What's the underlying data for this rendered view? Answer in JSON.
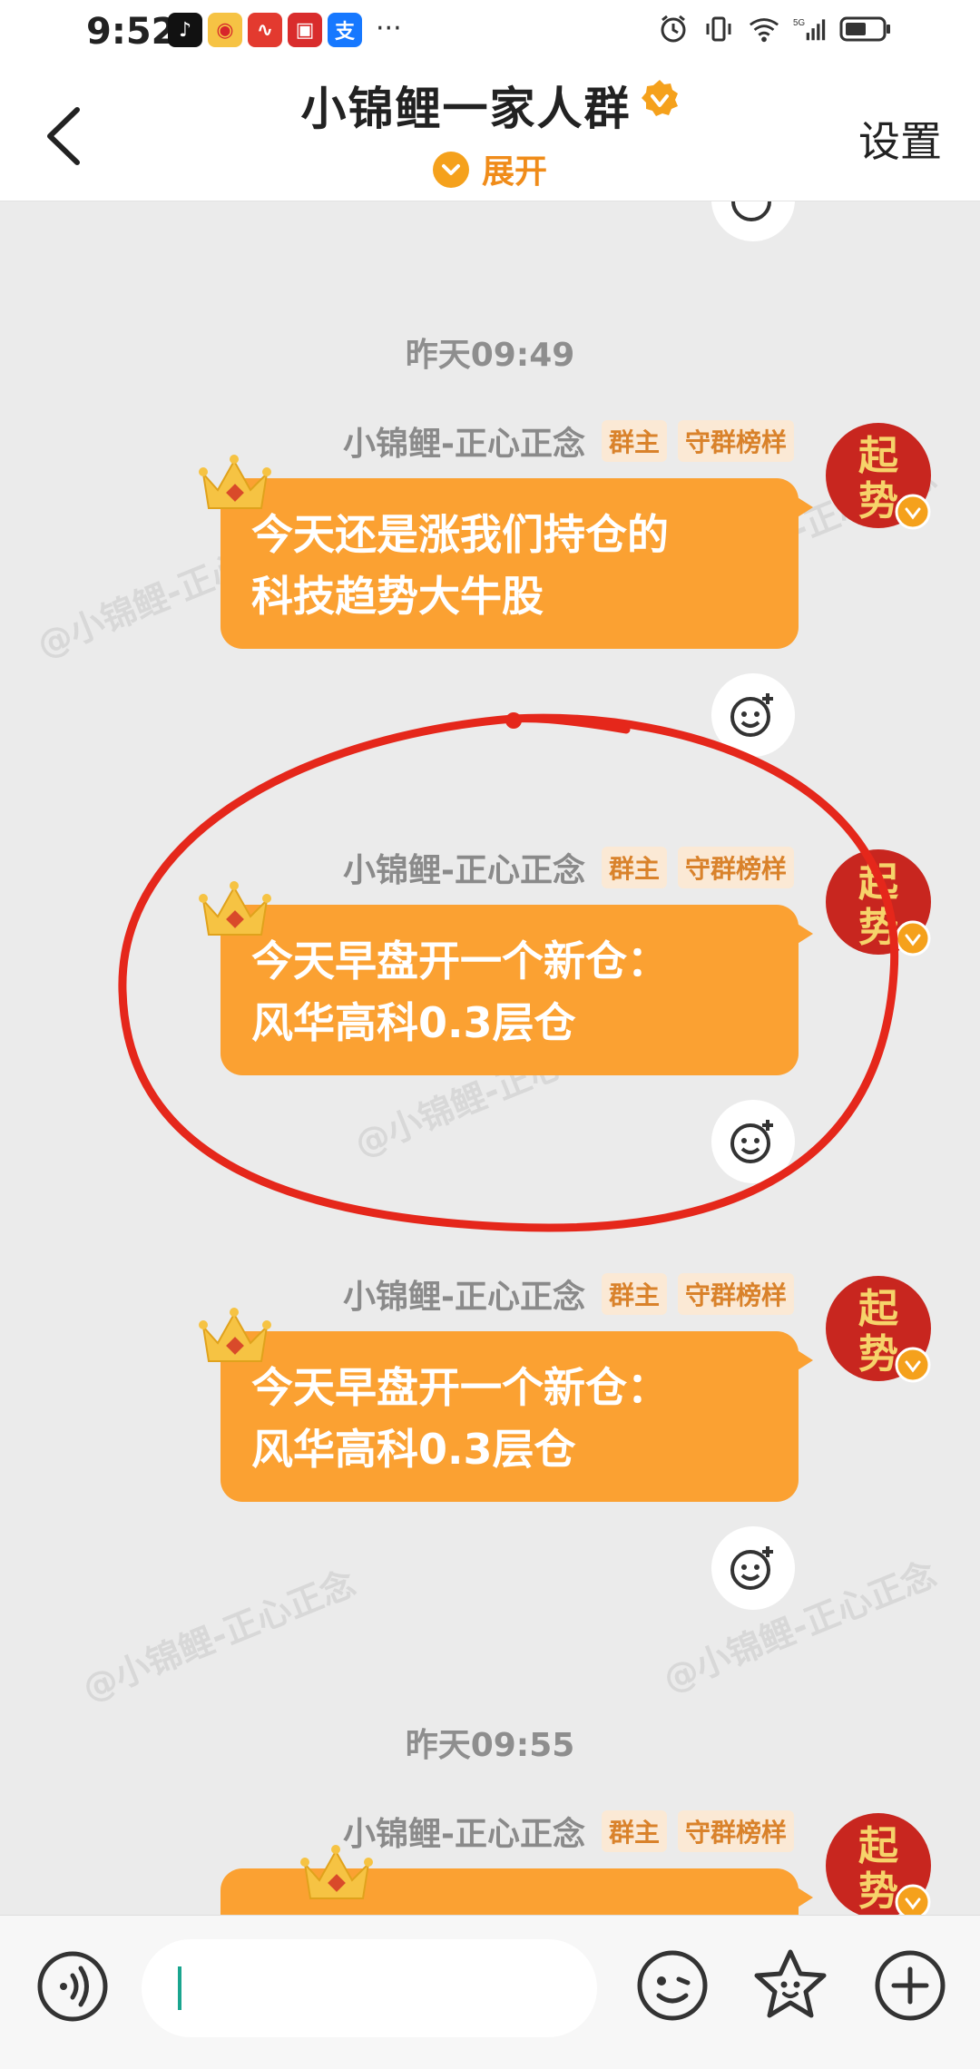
{
  "status_bar": {
    "time": "9:52",
    "app_icons": [
      "tiktok-icon",
      "weibo-icon",
      "netease-music-icon",
      "news-icon",
      "alipay-icon"
    ],
    "more": "···"
  },
  "header": {
    "title": "小锦鲤一家人群",
    "expand_label": "展开",
    "settings_label": "设置"
  },
  "chat": {
    "messages": [
      {
        "timestamp": "昨天09:49",
        "sender": "小锦鲤-正心正念",
        "tags": [
          "群主",
          "守群榜样"
        ],
        "avatar_text": "起势",
        "lines": [
          "今天还是涨我们持仓的",
          "科技趋势大牛股"
        ]
      },
      {
        "sender": "小锦鲤-正心正念",
        "tags": [
          "群主",
          "守群榜样"
        ],
        "avatar_text": "起势",
        "lines": [
          "今天早盘开一个新仓：",
          "风华高科0.3层仓"
        ]
      },
      {
        "sender": "小锦鲤-正心正念",
        "tags": [
          "群主",
          "守群榜样"
        ],
        "avatar_text": "起势",
        "lines": [
          "今天早盘开一个新仓：",
          "风华高科0.3层仓"
        ]
      },
      {
        "timestamp": "昨天09:55",
        "sender": "小锦鲤-正心正念",
        "tags": [
          "群主",
          "守群榜样"
        ],
        "avatar_text": "起势"
      }
    ],
    "watermark": "@小锦鲤-正心正念"
  },
  "input_bar": {
    "text_value": ""
  },
  "colors": {
    "bubble": "#fba132",
    "accent": "#f5a11c",
    "annotation_circle": "#e5271b",
    "tag_text": "#d9822b"
  }
}
